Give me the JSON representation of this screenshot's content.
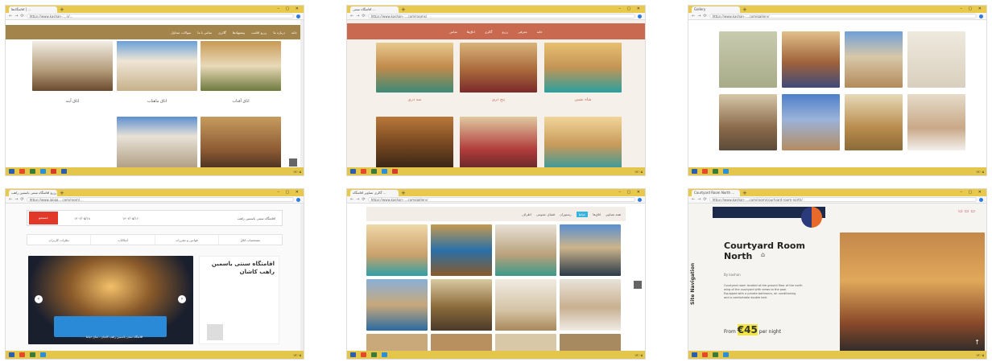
{
  "window_controls": "– ▢ ✕",
  "screens": [
    {
      "tabs": [
        "اقامتگاه‌ها | ..."
      ],
      "url": "https://www.kashan-....ir/...",
      "menu": [
        "خانه",
        "درباره ما",
        "رزرو اقامت",
        "پیشنهادها",
        "گالری",
        "تماس با ما",
        "سوالات متداول"
      ],
      "captions": [
        "اتاق آفتاب",
        "اتاق ماهتاب",
        "اتاق آینه"
      ]
    },
    {
      "tabs": [
        "اقامتگاه سنتی ..."
      ],
      "url": "https://www.kashan-....com/rooms/",
      "menu": [
        "خانه",
        "معرفی",
        "رزرو",
        "گالری",
        "اتاق‌ها",
        "تماس"
      ],
      "captions": [
        "سه دری",
        "پنج دری",
        "شاه نشین"
      ]
    },
    {
      "tabs": [
        "Gallery"
      ],
      "url": "https://www.kashan-....com/gallery/"
    },
    {
      "tabs": [
        "رزرو اقامتگاه سنتی یاسمین راهب ..."
      ],
      "url": "https://www.jajiga....com/room/...",
      "search_placeholder": "اقامتگاه سنتی یاسمین راهب",
      "date_in": "۱۴۰۲/۰۵/۱۶",
      "date_out": "۱۴۰۲/۰۵/۱۸",
      "search_btn": "جستجو",
      "sub_tabs": [
        "مشخصات اتاق",
        "قوانین و مقررات",
        "امکانات",
        "نظرات کاربران"
      ],
      "title": "اقامتگاه سنتی یاسمین راهب کاشان",
      "caption": "اقامتگاه سنتی یاسمین راهب کاشان - نمای حیاط"
    },
    {
      "tabs": [
        "گالری تصاویر اقامتگاه ..."
      ],
      "url": "https://www.kashan-....com/gallery/",
      "menu": [
        "همه تصاویر",
        "اتاق‌ها",
        "حیاط",
        "رستوران",
        "فضای عمومی",
        "اطراف"
      ]
    },
    {
      "tabs": [
        "Courtyard Room North ..."
      ],
      "url": "https://www.kashan-....com/room/courtyard-room-north/",
      "site_nav": "Site Navigation",
      "title": "Courtyard Room North",
      "author": "By kashan",
      "desc": [
        "Courtyard room located at the ground floor of the north",
        "wing of the courtyard with views to the pool.",
        "Equipped with a private bathroom, air conditioning",
        "and a comfortable double bed."
      ],
      "price_prefix": "From",
      "price": "€45",
      "price_suffix": "per night"
    }
  ],
  "taskbar_time": "۱۴:۰۵"
}
